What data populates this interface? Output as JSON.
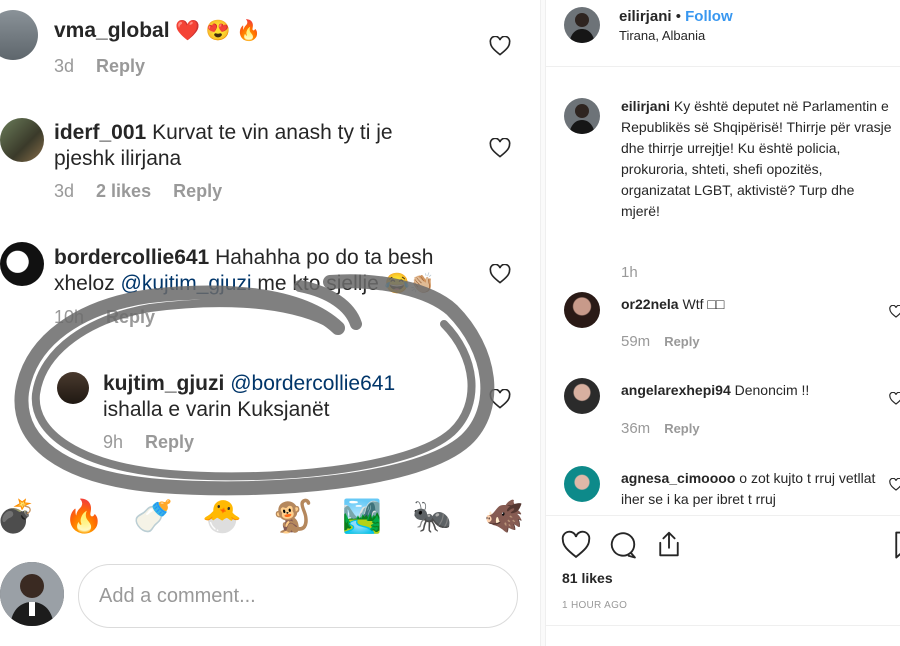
{
  "left_comments": [
    {
      "username": "vma_global",
      "text": "",
      "emoji": "❤️ 😍 🔥",
      "time": "3d",
      "likes": "",
      "reply_label": "Reply"
    },
    {
      "username": "iderf_001",
      "text": "Kurvat te vin anash ty ti je pjeshk ilirjana",
      "time": "3d",
      "likes": "2 likes",
      "reply_label": "Reply"
    },
    {
      "username": "bordercollie641",
      "text_before": "Hahahha po do ta besh xheloz ",
      "mention": "@kujtim_gjuzi",
      "text_after": " me kto sjellje ",
      "emoji": "😂👏🏼",
      "time": "10h",
      "likes": "",
      "reply_label": "Reply"
    },
    {
      "username": "kujtim_gjuzi",
      "mention": "@bordercollie641",
      "text_after": "ishalla e varin Kuksjanët",
      "time": "9h",
      "likes": "",
      "reply_label": "Reply"
    }
  ],
  "emoji_bar": [
    "💣",
    "🔥",
    "🍼",
    "🐣",
    "🐒",
    "🏞️",
    "🐜",
    "🐗"
  ],
  "comment_input": {
    "placeholder": "Add a comment..."
  },
  "post": {
    "username": "eilirjani",
    "follow_label": "Follow",
    "separator": "•",
    "location": "Tirana, Albania",
    "caption": "Ky është deputet në Parlamentin e Republikës së Shqipërisë! Thirrje për vrasje dhe thirrje urrejtje! Ku është policia, prokuroria, shteti, shefi opozitës, organizatat LGBT, aktivistë? Turp dhe mjerë!",
    "caption_time": "1h"
  },
  "right_comments": [
    {
      "username": "or22nela",
      "text": "Wtf □□",
      "time": "59m",
      "reply_label": "Reply"
    },
    {
      "username": "angelarexhepi94",
      "text": "Denoncim !!",
      "time": "36m",
      "reply_label": "Reply"
    },
    {
      "username": "agnesa_cimoooo",
      "text": "o zot kujto t rruj vetllat iher se i ka per ibret t rruj",
      "time": "",
      "reply_label": ""
    }
  ],
  "likes_count": "81 likes",
  "post_time": "1 HOUR AGO",
  "icons": {
    "heart": "heart-icon",
    "comment": "comment-icon",
    "share": "share-icon",
    "bookmark": "bookmark-icon"
  }
}
